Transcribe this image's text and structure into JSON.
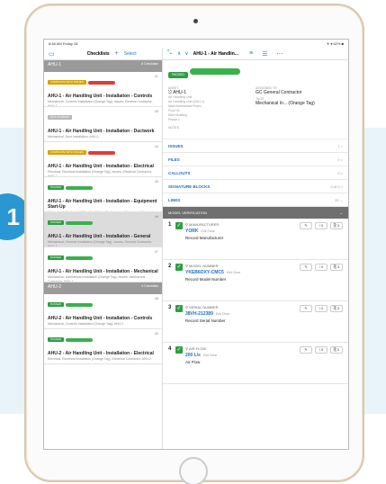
{
  "step": "1",
  "status_bar": {
    "time": "8:48 AM  Friday 28",
    "battery": "✦ ▾ 62% ■"
  },
  "navbar": {
    "left_title": "Checklists",
    "add_label": "+",
    "select_label": "Select",
    "right_title": "AHU-1 - Air Handlin..."
  },
  "groups": [
    {
      "name": "AHU-1",
      "count": "8 Checklists",
      "items": [
        {
          "chip": "COMPLETE WITH ISSUES",
          "chip_color": "#d8a200",
          "bar_color": "#e33a3a",
          "num": "#1",
          "title": "AHU-1 - Air Handling Unit - Installation - Controls",
          "sub": "Mechanical, Controls Installation (Orange Tag), Issues, General Contractor, AHU-1",
          "selected": false
        },
        {
          "chip": "NOT STARTED",
          "chip_color": "#b9b9b9",
          "bar_color": "",
          "num": "#3",
          "title": "AHU-1 - Air Handling Unit - Installation - Ductwork",
          "sub": "Mechanical, Duct Installation, AHU-1",
          "selected": false
        },
        {
          "chip": "COMPLETE WITH ISSUES",
          "chip_color": "#d8a200",
          "bar_color": "#e33a3a",
          "num": "#4",
          "title": "AHU-1 - Air Handling Unit - Installation - Electrical",
          "sub": "Electrical, Electrical Installation (Orange Tag), Issues, Electrical Contractor, AHU-1",
          "selected": false
        },
        {
          "chip": "PASSED",
          "chip_color": "#2f9e44",
          "bar_color": "#38b24a",
          "num": "#5",
          "title": "AHU-1 - Air Handling Unit - Installation - Equipment Start-Up",
          "sub": "Mechanical, Mechanical Start-Up (Yellow Tag), Issues, Mechanical Contractor, AHU-1",
          "selected": false
        },
        {
          "chip": "PASSED",
          "chip_color": "#2f9e44",
          "bar_color": "#38b24a",
          "num": "#6",
          "title": "AHU-1 - Air Handling Unit - Installation - General",
          "sub": "Mechanical, General Installation (Orange Tag), Issues, General Contractor, AHU-1",
          "selected": true
        },
        {
          "chip": "PASSED",
          "chip_color": "#2f9e44",
          "bar_color": "#38b24a",
          "num": "#7",
          "title": "AHU-1 - Air Handling Unit - Installation - Mechanical",
          "sub": "Mechanical, Mechanical Installation (Orange Tag), Issues, Mechanical Contractor, AHU-1",
          "selected": false
        }
      ]
    },
    {
      "name": "AHU-2",
      "count": "4 Checklists",
      "items": [
        {
          "chip": "PASSED",
          "chip_color": "#2f9e44",
          "bar_color": "#38b24a",
          "num": "#8",
          "title": "AHU-2 - Air Handling Unit - Installation - Controls",
          "sub": "Mechanical, Controls Installation (Orange Tag), AHU-2",
          "selected": false
        },
        {
          "chip": "PASSED",
          "chip_color": "#2f9e44",
          "bar_color": "#38b24a",
          "num": "#9",
          "title": "AHU-2 - Air Handling Unit - Installation - Electrical",
          "sub": "Electrical, Electrical Installation (Orange Tag), Electrical Contractor, AHU-2",
          "selected": false
        }
      ]
    }
  ],
  "detail": {
    "status": "PASSED",
    "asset_label": "ASSET",
    "asset_value": "AHU-1",
    "asset_meta": [
      "Air Handling Unit",
      "Air Handling Unit (AHU-1)",
      "Main Mechanical Room",
      "Floor 01",
      "Main Building",
      "Phase 1"
    ],
    "notes_label": "NOTES",
    "assigned_label": "ASSIGNED TO",
    "assigned_value": "GC General Contractor",
    "tags_label": "TAGS",
    "tags_value": "Mechanical In... (Orange Tag)"
  },
  "sections": [
    {
      "label": "ISSUES",
      "count": "1 >"
    },
    {
      "label": "FILES",
      "count": "0 >"
    },
    {
      "label": "CALLOUTS",
      "count": "0 >"
    },
    {
      "label": "SIGNATURE BLOCKS",
      "count": "0 of 0 >"
    },
    {
      "label": "LINES",
      "count": "20 ⌄"
    }
  ],
  "model_verification": {
    "title": "MODEL VERIFICATION",
    "toggle": "⌄"
  },
  "questions": [
    {
      "num": "1",
      "label": "MANUFACTURER",
      "value": "YORK",
      "edit": "Edit   Clear",
      "desc": "Record Manufacturer"
    },
    {
      "num": "2",
      "label": "MODEL NUMBER",
      "value": "YKEB6OXY-CMC5",
      "edit": "Edit   Clear",
      "desc": "Record Model Number"
    },
    {
      "num": "3",
      "label": "SERIAL NUMBER",
      "value": "38VH-212389",
      "edit": "Edit   Clear",
      "desc": "Record Serial Number"
    },
    {
      "num": "4",
      "label": "AIR FLOW",
      "value": "200 L/s",
      "edit": "Edit   Clear",
      "desc": "Air Flow"
    }
  ],
  "actions": {
    "edit": "✎",
    "issue": "! 0",
    "attach": "⎘ 0"
  }
}
